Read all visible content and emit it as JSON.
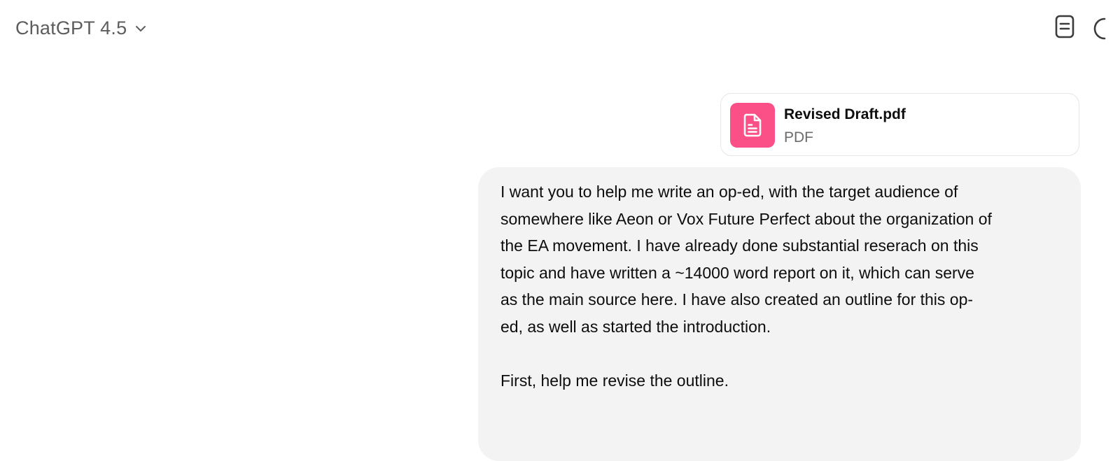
{
  "header": {
    "model_label": "ChatGPT 4.5",
    "model_chevron_icon": "chevron-down-icon",
    "doc_button_icon": "document-icon"
  },
  "attachment": {
    "file_name": "Revised Draft.pdf",
    "file_type": "PDF",
    "icon": "file-document-icon",
    "icon_bg_color": "#fa4f87"
  },
  "message": {
    "paragraphs": [
      "I want you to help me write an op-ed, with the target audience of\nsomewhere like Aeon or Vox Future Perfect about the organization of\nthe EA movement. I have already done substantial reserach on this\ntopic and have written a ~14000 word report on it, which can serve\nas the main source here. I have also created an outline for this op-\ned, as well as started the introduction.",
      "First, help me revise the outline."
    ],
    "bubble_color": "#f3f3f3"
  }
}
